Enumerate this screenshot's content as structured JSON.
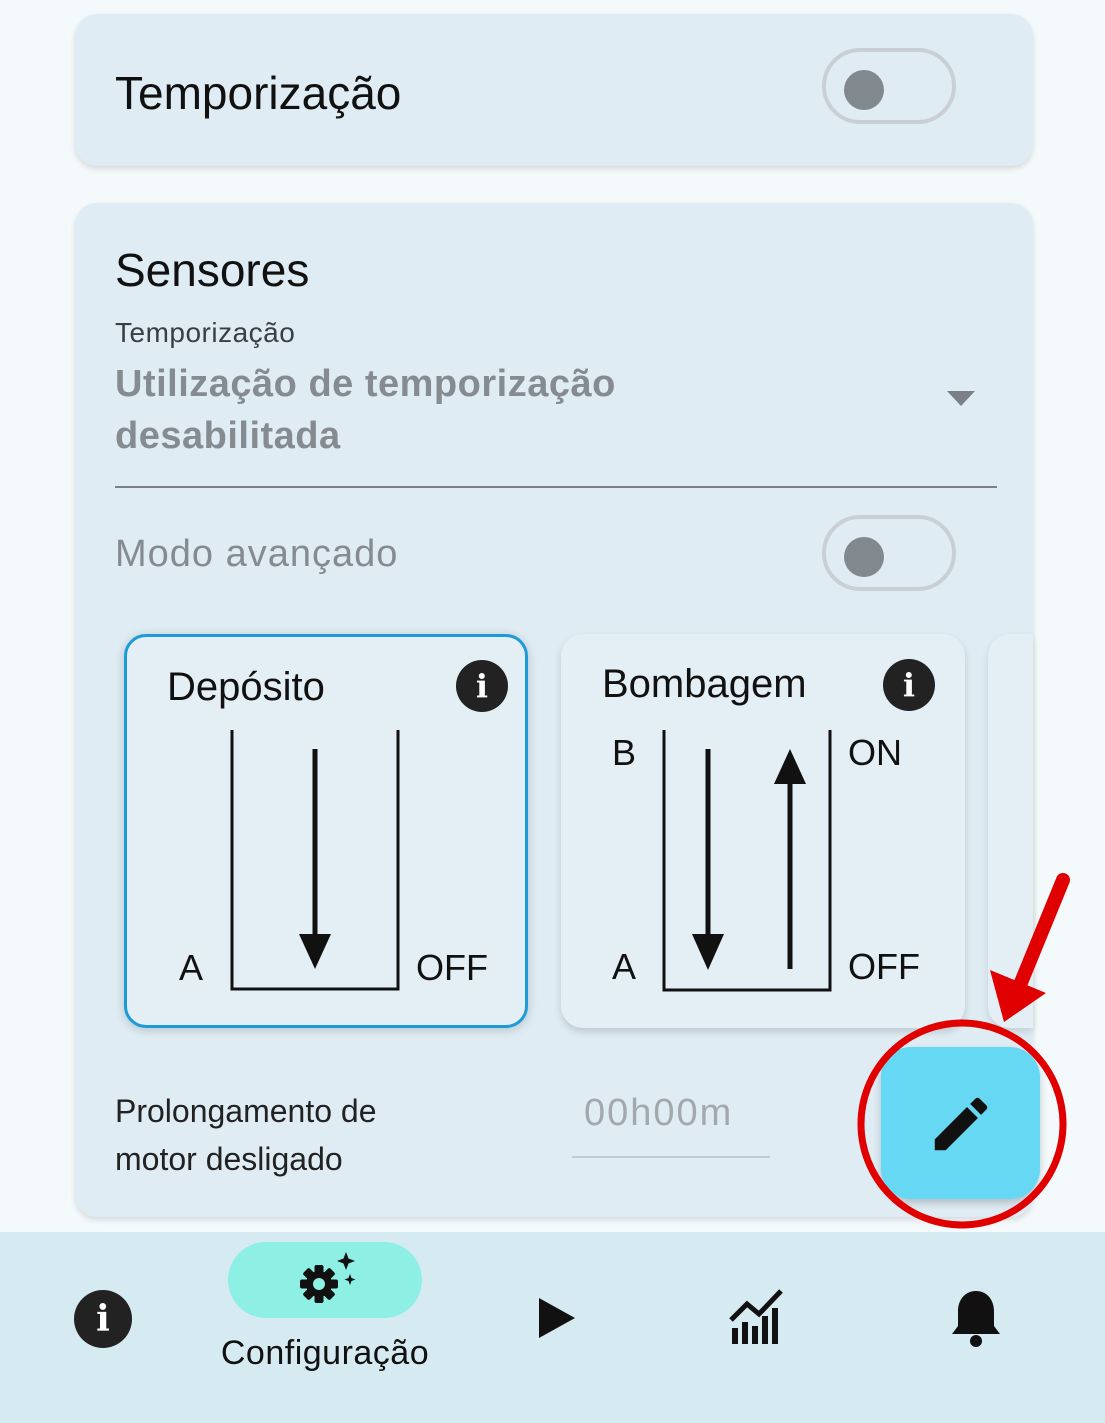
{
  "timing_card": {
    "title": "Temporização",
    "toggle_on": false
  },
  "sensors": {
    "title": "Sensores",
    "timing_select": {
      "label": "Temporização",
      "value_line1": "Utilização de temporização",
      "value_line2": "desabilitada"
    },
    "advanced_mode": {
      "label": "Modo avançado",
      "toggle_on": false
    },
    "diagrams": [
      {
        "title": "Depósito",
        "selected": true,
        "left_bottom": "A",
        "right_bottom": "OFF",
        "info_icon": "info-icon"
      },
      {
        "title": "Bombagem",
        "selected": false,
        "left_top": "B",
        "left_bottom": "A",
        "right_top": "ON",
        "right_bottom": "OFF",
        "info_icon": "info-icon"
      }
    ],
    "extension": {
      "label_line1": "Prolongamento de",
      "label_line2": "motor desligado",
      "placeholder": "00h00m"
    }
  },
  "fab": {
    "icon": "pencil-icon",
    "color": "#66d8f4"
  },
  "annotation": {
    "circle_color": "#e00000",
    "arrow_color": "#e00000"
  },
  "bottom_nav": {
    "items": [
      {
        "icon": "info-icon",
        "label": ""
      },
      {
        "icon": "settings-sparkle-icon",
        "label": "Configuração",
        "active": true
      },
      {
        "icon": "play-icon",
        "label": ""
      },
      {
        "icon": "chart-icon",
        "label": ""
      },
      {
        "icon": "bell-icon",
        "label": ""
      }
    ],
    "active_pill_color": "#8eefe5"
  }
}
